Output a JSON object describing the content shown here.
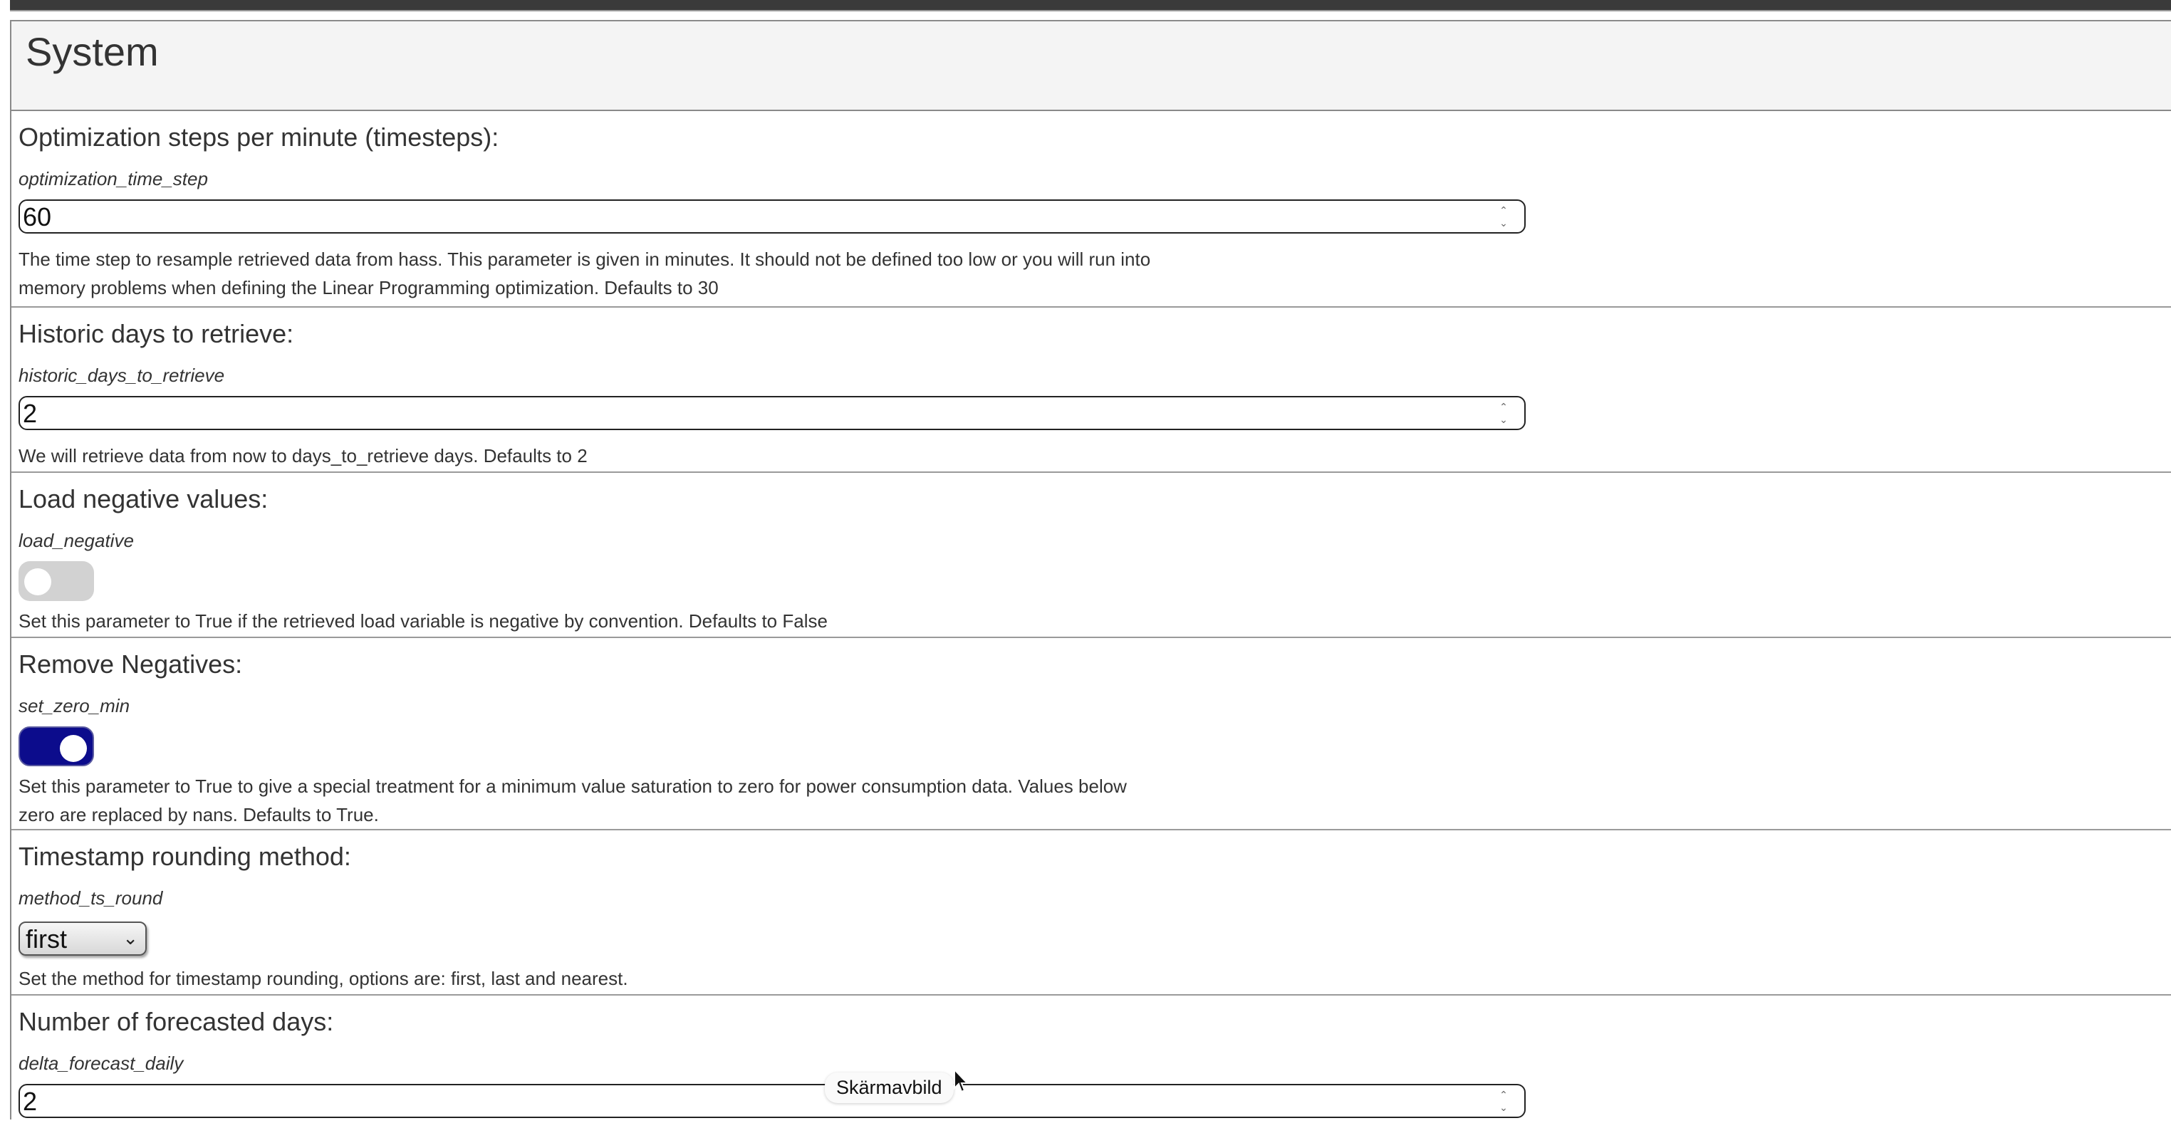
{
  "panel": {
    "title": "System"
  },
  "params": {
    "time_step": {
      "label": "Optimization steps per minute (timesteps):",
      "key": "optimization_time_step",
      "value": "60",
      "desc1": "The time step to resample retrieved data from hass. This parameter is given in minutes. It should not be defined too low or you will run into",
      "desc2": "memory problems when defining the Linear Programming optimization. Defaults to 30"
    },
    "historic_days": {
      "label": "Historic days to retrieve:",
      "key": "historic_days_to_retrieve",
      "value": "2",
      "desc1": "We will retrieve data from now to days_to_retrieve days. Defaults to 2"
    },
    "load_negative": {
      "label": "Load negative values:",
      "key": "load_negative",
      "state": "off",
      "desc1": "Set this parameter to True if the retrieved load variable is negative by convention. Defaults to False"
    },
    "set_zero_min": {
      "label": "Remove Negatives:",
      "key": "set_zero_min",
      "state": "on",
      "desc1": "Set this parameter to True to give a special treatment for a minimum value saturation to zero for power consumption data. Values below",
      "desc2": "zero are replaced by nans. Defaults to True."
    },
    "ts_round": {
      "label": "Timestamp rounding method:",
      "key": "method_ts_round",
      "selected": "first",
      "desc1": "Set the method for timestamp rounding, options are: first, last and nearest."
    },
    "forecast_days": {
      "label": "Number of forecasted days:",
      "key": "delta_forecast_daily",
      "value": "2"
    }
  },
  "tooltip": {
    "text": "Skärmavbild"
  },
  "colors": {
    "toggle_on": "#0c0c8c",
    "toggle_off": "#d2d2d2"
  },
  "icons": {
    "spinner": "spinner-icon",
    "chevron": "chevron-down-icon",
    "cursor": "mouse-cursor-icon"
  }
}
